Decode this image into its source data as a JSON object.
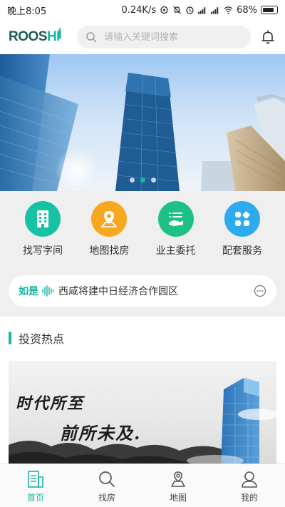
{
  "status_bar": {
    "time": "晚上8:05",
    "speed": "0.24K/s",
    "battery": "68%"
  },
  "header": {
    "logo_text_main": "ROOS",
    "logo_text_accent": "HI",
    "search_placeholder": "请输入关键词搜索",
    "search_icon": "search-icon",
    "bell_icon": "bell-icon"
  },
  "banner": {
    "slide_count": 3,
    "active_slide": 2
  },
  "services": [
    {
      "label": "找写字间",
      "color": "#17c2a4",
      "icon": "building-icon"
    },
    {
      "label": "地图找房",
      "color": "#f7a81e",
      "icon": "map-pin-icon"
    },
    {
      "label": "业主委托",
      "color": "#1ec184",
      "icon": "hand-list-icon"
    },
    {
      "label": "配套服务",
      "color": "#2eabf0",
      "icon": "grid-diamond-icon"
    }
  ],
  "notice": {
    "tag": "如是",
    "text": "西咸将建中日经济合作园区"
  },
  "section": {
    "title": "投资热点"
  },
  "hot_card": {
    "line1": "时代所至",
    "line2": "前所未及."
  },
  "tabbar": [
    {
      "label": "首页",
      "icon": "home-doc-icon",
      "active": true
    },
    {
      "label": "找房",
      "icon": "search-icon",
      "active": false
    },
    {
      "label": "地图",
      "icon": "map-icon",
      "active": false
    },
    {
      "label": "我的",
      "icon": "user-icon",
      "active": false
    }
  ],
  "colors": {
    "accent": "#17b7a7"
  }
}
